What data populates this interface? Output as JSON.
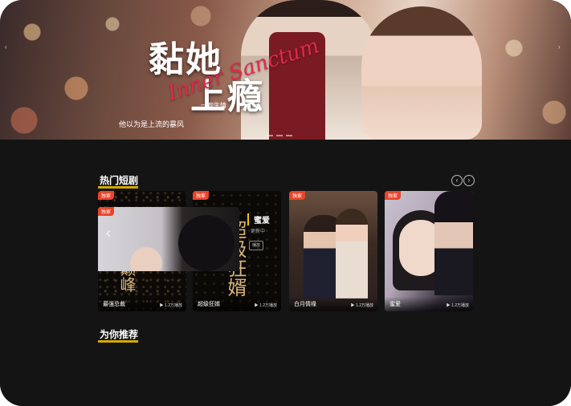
{
  "banner": {
    "title_line1": "黏她",
    "title_line2": "上瘾",
    "title_en": "Inner Sanctum",
    "subtitle": "他以为是上流的暴风",
    "slogan": "一吻生情"
  },
  "hot": {
    "title": "热门短剧",
    "prev_icon": "‹",
    "next_icon": "›",
    "cards": [
      {
        "tag": "独家",
        "name": "最强总裁",
        "meta": "▶ 1.2万播放",
        "art": "权力 巅峰"
      },
      {
        "tag": "独家",
        "name": "超级狂婿",
        "meta": "▶ 1.2万播放",
        "art": "超级狂婿"
      },
      {
        "tag": "独家",
        "name": "白月情缘",
        "meta": "▶ 1.2万播放",
        "art": ""
      },
      {
        "tag": "独家",
        "name": "蜜爱",
        "meta": "▶ 1.2万播放",
        "art": ""
      }
    ]
  },
  "recommend": {
    "title": "为你推荐",
    "tag": "独家",
    "feature_title": "蜜爱",
    "feature_sub": "更新中",
    "feature_btn": "播放"
  }
}
